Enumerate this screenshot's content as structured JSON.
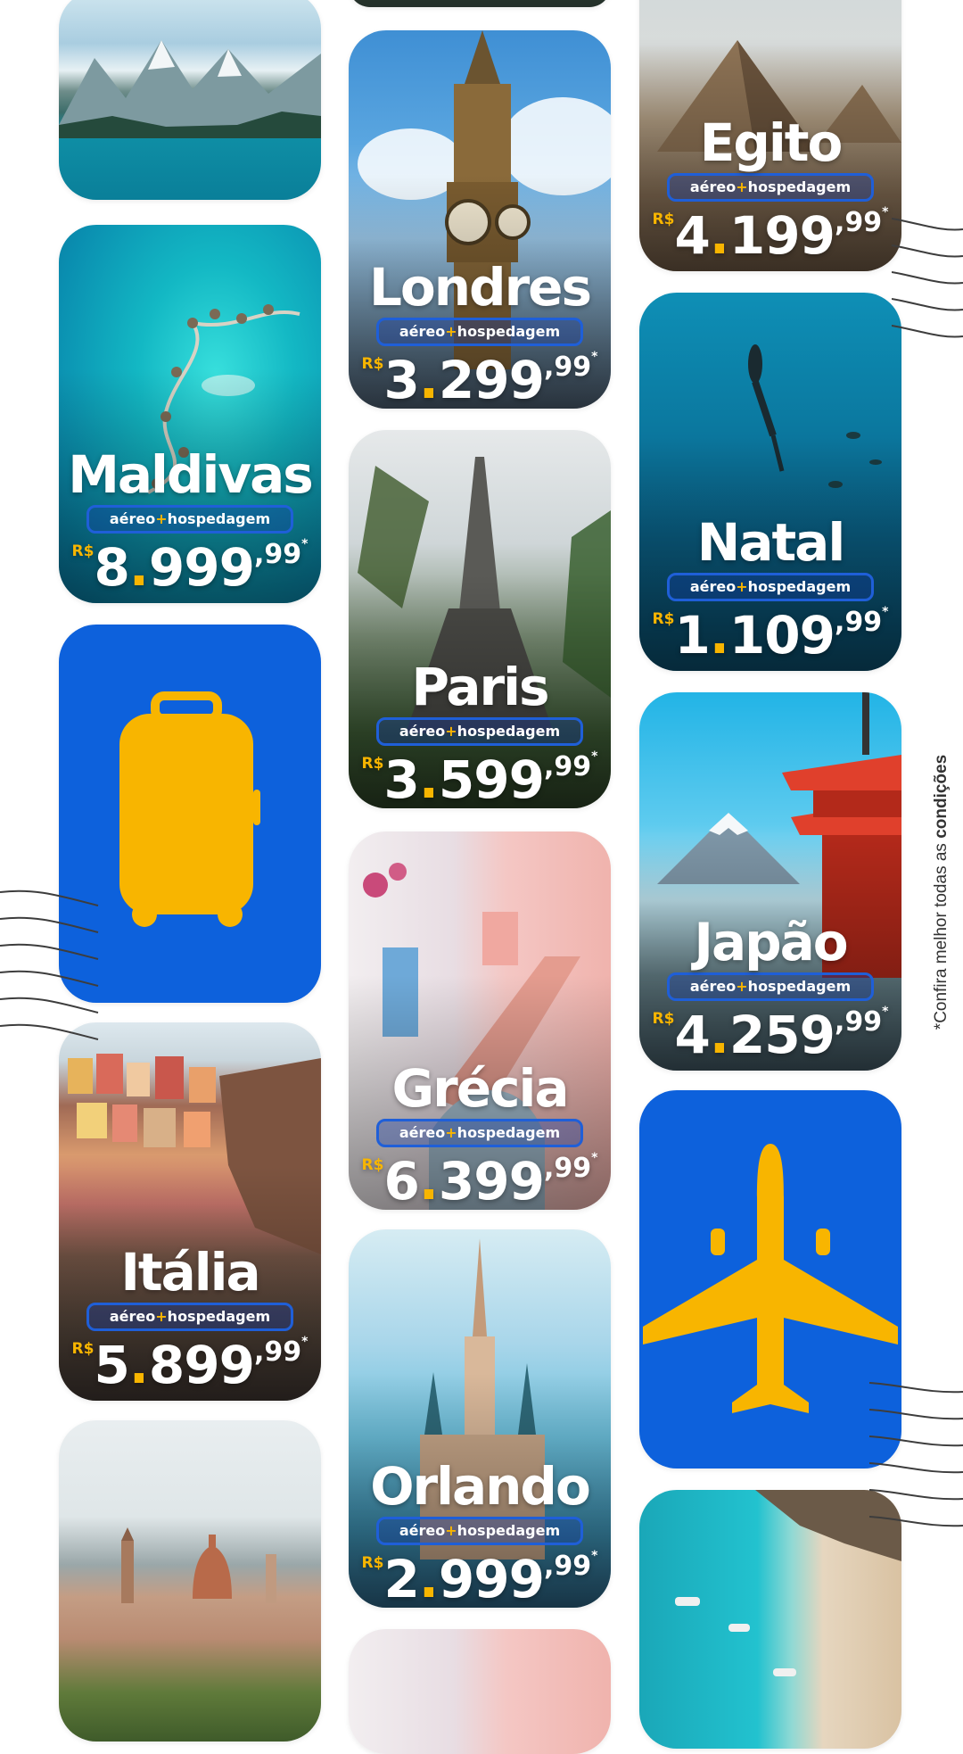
{
  "cards": [
    {
      "destination": "Maldivas",
      "package": {
        "a": "aéreo",
        "plus": "+",
        "b": "hospedagem"
      },
      "price": {
        "currency": "R$",
        "int_a": "8",
        "int_b": "999",
        "cents": ",99",
        "note": "*"
      }
    },
    {
      "destination": "Itália",
      "package": {
        "a": "aéreo",
        "plus": "+",
        "b": "hospedagem"
      },
      "price": {
        "currency": "R$",
        "int_a": "5",
        "int_b": "899",
        "cents": ",99",
        "note": "*"
      }
    },
    {
      "destination": "Londres",
      "package": {
        "a": "aéreo",
        "plus": "+",
        "b": "hospedagem"
      },
      "price": {
        "currency": "R$",
        "int_a": "3",
        "int_b": "299",
        "cents": ",99",
        "note": "*"
      }
    },
    {
      "destination": "Paris",
      "package": {
        "a": "aéreo",
        "plus": "+",
        "b": "hospedagem"
      },
      "price": {
        "currency": "R$",
        "int_a": "3",
        "int_b": "599",
        "cents": ",99",
        "note": "*"
      }
    },
    {
      "destination": "Grécia",
      "package": {
        "a": "aéreo",
        "plus": "+",
        "b": "hospedagem"
      },
      "price": {
        "currency": "R$",
        "int_a": "6",
        "int_b": "399",
        "cents": ",99",
        "note": "*"
      }
    },
    {
      "destination": "Orlando",
      "package": {
        "a": "aéreo",
        "plus": "+",
        "b": "hospedagem"
      },
      "price": {
        "currency": "R$",
        "int_a": "2",
        "int_b": "999",
        "cents": ",99",
        "note": "*"
      }
    },
    {
      "destination": "Egito",
      "package": {
        "a": "aéreo",
        "plus": "+",
        "b": "hospedagem"
      },
      "price": {
        "currency": "R$",
        "int_a": "4",
        "int_b": "199",
        "cents": ",99",
        "note": "*"
      }
    },
    {
      "destination": "Natal",
      "package": {
        "a": "aéreo",
        "plus": "+",
        "b": "hospedagem"
      },
      "price": {
        "currency": "R$",
        "int_a": "1",
        "int_b": "109",
        "cents": ",99",
        "note": "*"
      }
    },
    {
      "destination": "Japão",
      "package": {
        "a": "aéreo",
        "plus": "+",
        "b": "hospedagem"
      },
      "price": {
        "currency": "R$",
        "int_a": "4",
        "int_b": "259",
        "cents": ",99",
        "note": "*"
      }
    }
  ],
  "icons": {
    "suitcase": "suitcase-icon",
    "airplane": "airplane-icon"
  },
  "colors": {
    "brand_blue": "#0d61dc",
    "accent_yellow": "#f8b500",
    "pill_border": "#1f5fd8"
  },
  "side_note": {
    "prefix": "*Confira melhor todas as",
    "bold": "condições"
  }
}
